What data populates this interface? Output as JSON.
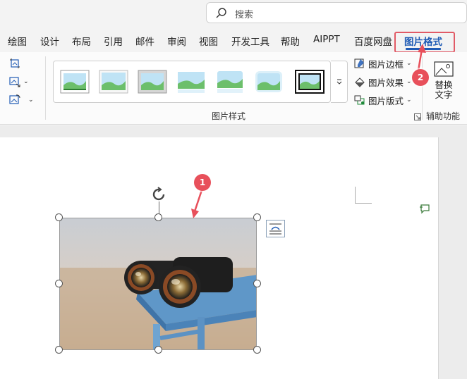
{
  "search": {
    "placeholder": "搜索",
    "icon": "search-icon"
  },
  "tabs": [
    {
      "label": "绘图"
    },
    {
      "label": "设计"
    },
    {
      "label": "布局"
    },
    {
      "label": "引用"
    },
    {
      "label": "邮件"
    },
    {
      "label": "审阅"
    },
    {
      "label": "视图"
    },
    {
      "label": "开发工具"
    },
    {
      "label": "帮助"
    },
    {
      "label": "AIPPT"
    },
    {
      "label": "百度网盘"
    },
    {
      "label": "图片格式",
      "active": true
    }
  ],
  "ribbon": {
    "picture_styles_group_label": "图片样式",
    "accessibility_group_label": "辅助功能",
    "options": [
      {
        "label": "图片边框",
        "icon": "pen-border-icon"
      },
      {
        "label": "图片效果",
        "icon": "effects-icon"
      },
      {
        "label": "图片版式",
        "icon": "layout-icon"
      }
    ],
    "alt_text_label_line1": "替换",
    "alt_text_label_line2": "文字",
    "style_gallery_count": 7
  },
  "annotations": [
    {
      "number": "1"
    },
    {
      "number": "2"
    }
  ],
  "colors": {
    "accent": "#1f5bb5",
    "highlight": "#e15a66",
    "badge": "#e8505b"
  }
}
